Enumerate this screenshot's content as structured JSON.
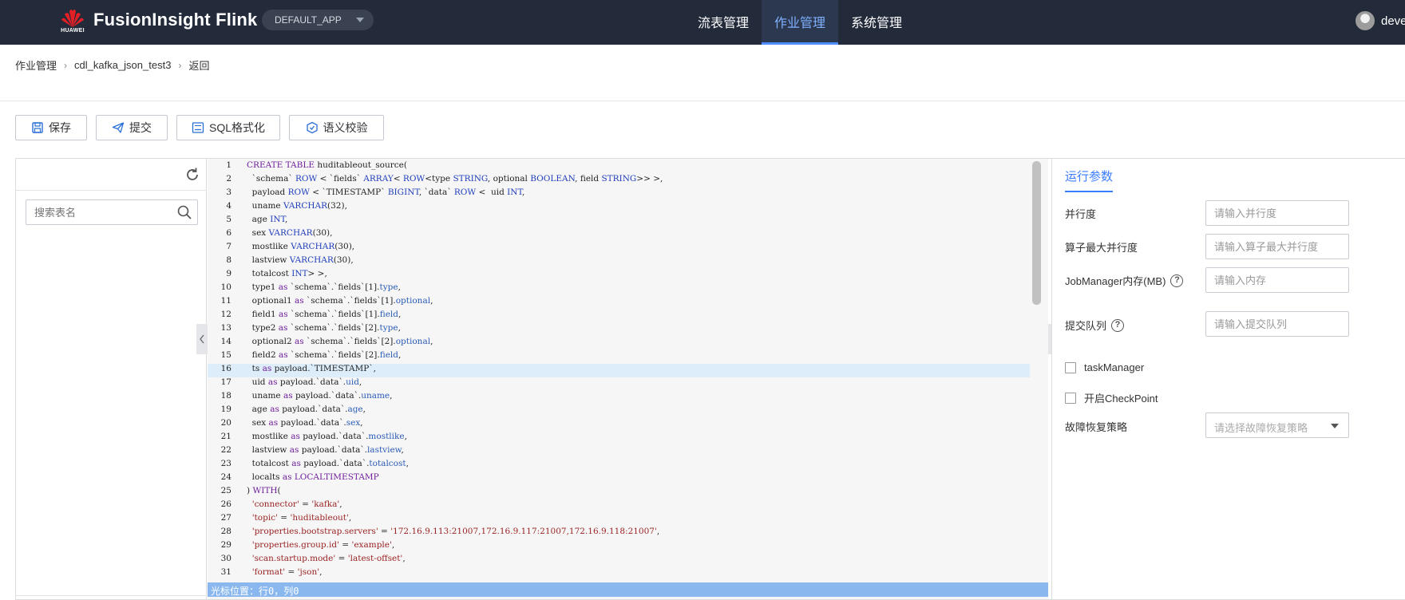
{
  "header": {
    "logo_text": "HUAWEI",
    "brand": "FusionInsight Flink",
    "app_select": "DEFAULT_APP",
    "nav": [
      "流表管理",
      "作业管理",
      "系统管理"
    ],
    "active_nav": "作业管理",
    "user": "deve"
  },
  "breadcrumb": [
    "作业管理",
    "cdl_kafka_json_test3",
    "返回"
  ],
  "toolbar": {
    "save": "保存",
    "submit": "提交",
    "format": "SQL格式化",
    "validate": "语义校验"
  },
  "left_panel": {
    "search_placeholder": "搜索表名"
  },
  "editor": {
    "current_line": 16,
    "status": "光标位置：行0，列0"
  },
  "right_panel": {
    "tab": "运行参数",
    "parallelism_label": "并行度",
    "parallelism_placeholder": "请输入并行度",
    "max_parallelism_label": "算子最大并行度",
    "max_parallelism_placeholder": "请输入算子最大并行度",
    "jm_memory_label": "JobManager内存(MB)",
    "jm_memory_placeholder": "请输入内存",
    "queue_label": "提交队列",
    "queue_placeholder": "请输入提交队列",
    "task_manager_label": "taskManager",
    "checkpoint_label": "开启CheckPoint",
    "recovery_label": "故障恢复策略",
    "recovery_placeholder": "请选择故障恢复策略"
  },
  "colors": {
    "topbar": "#232b3b",
    "accent": "#3b7cff",
    "status_bar": "#8ab8ee"
  },
  "icons": [
    "huawei-logo-icon",
    "chevron-down-icon",
    "save-icon",
    "submit-icon",
    "format-icon",
    "validate-icon",
    "refresh-icon",
    "search-icon",
    "chevron-left-icon",
    "chevron-right-icon",
    "help-icon"
  ]
}
